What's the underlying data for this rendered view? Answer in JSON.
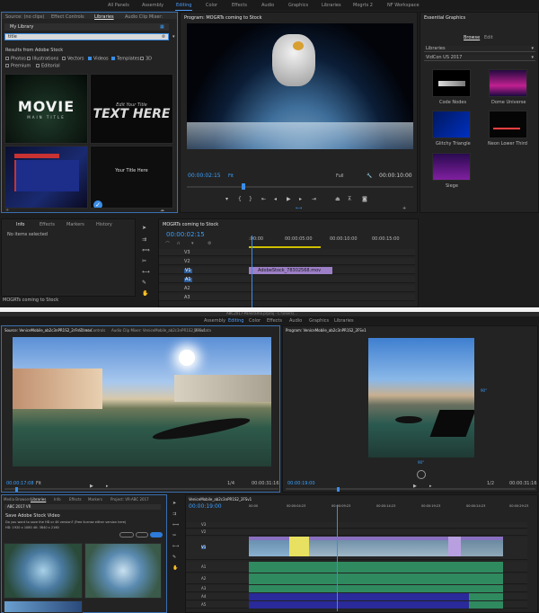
{
  "shot1": {
    "workspaces": [
      "All Panels",
      "Assembly",
      "Editing",
      "Color",
      "Effects",
      "Audio",
      "Graphics",
      "Libraries",
      "Mogrts 2",
      "NF Workspace"
    ],
    "source_tabs": [
      "Source: (no clips)",
      "Effect Controls",
      "Libraries",
      "Audio Clip Mixer:"
    ],
    "library_name": "My Library",
    "search_value": "title",
    "results_header": "Results from Adobe Stock",
    "filters": [
      {
        "label": "Photos",
        "on": false
      },
      {
        "label": "Illustrations",
        "on": false
      },
      {
        "label": "Vectors",
        "on": false
      },
      {
        "label": "Videos",
        "on": true
      },
      {
        "label": "Templates",
        "on": true
      },
      {
        "label": "3D",
        "on": false
      },
      {
        "label": "Premium",
        "on": false
      },
      {
        "label": "Editorial",
        "on": false
      }
    ],
    "thumb_movie": "MOVIE",
    "thumb_movie_sub": "MAIN TITLE",
    "thumb_edit": "Edit Your Title",
    "thumb_text": "TEXT HERE",
    "thumb_your_title": "Your Title Here",
    "program_title": "Program: MOGRTs coming to Stock",
    "timecode_in": "00:00:02:15",
    "fit": "Fit",
    "full": "Full",
    "timecode_end": "00:00:10:00",
    "info_tabs": [
      "Info",
      "Effects",
      "Markers",
      "History"
    ],
    "no_items": "No items selected",
    "bottom_label": "MOGRTs coming to Stock",
    "seq_title": "MOGRTs coming to Stock",
    "seq_time": "00:00:02:15",
    "ruler": [
      ":00:00",
      "00:00:05:00",
      "00:00:10:00",
      "00:00:15:00"
    ],
    "clip_name": "AdobeStock_78302568.mov",
    "tracks": [
      "V3",
      "V2",
      "V1",
      "A1",
      "A2",
      "A3"
    ],
    "eg_title": "Essential Graphics",
    "eg_tabs": [
      "Browse",
      "Edit"
    ],
    "eg_dropdown1": "Libraries",
    "eg_dropdown2": "VidCon US 2017",
    "eg_items": [
      "Code Nodes",
      "Dome Universe",
      "Glitchy Triangle",
      "Neon Lower Third",
      "Siege"
    ]
  },
  "shot2": {
    "window_title": "ABC2017-Panorama.prproj - C:\\Users\\...",
    "workspaces": [
      "Assembly",
      "Editing",
      "Color",
      "Effects",
      "Audio",
      "Graphics",
      "Libraries"
    ],
    "source_title": "Source: VeniceMobile_ab2c3nPR1S2_2rFrn1.mov",
    "effect_controls": "Effect Controls",
    "audio_mixer": "Audio Clip Mixer: VeniceMobile_ab2c3nPR1S2_2FSv1",
    "metadata": "Metadata",
    "program_title": "Program: VeniceMobile_ab2c3nPR1S2_2FSv1",
    "src_tc": "00:00:17:08",
    "src_fit": "Fit",
    "src_full": "1/4",
    "src_end": "00:00:31:16",
    "prog_tc": "00:00:19:00",
    "prog_full": "1/2",
    "prog_end": "00:00:31:16",
    "angle_right": "90°",
    "angle_bottom": "90°",
    "lib_tabs": [
      "Media Browser",
      "Libraries",
      "Info",
      "Effects",
      "Markers",
      "Project: VR-ABC 2017"
    ],
    "lib_name": "ABC 2017 VR",
    "save_heading": "Save Adobe Stock Video",
    "save_question": "Do you want to save the HD or 4K version? (Free license either version here)",
    "save_sizes": "HD: 1920 x 1080    4K: 3840 x 2160",
    "btn_cancel": "Cancel",
    "btn_hd": "HD",
    "btn_4k": "4K",
    "seq_title": "VeniceMobile_ab2c3nPR1S2_2FSv1",
    "seq_time": "00:00:19:00",
    "ruler": [
      "00:00",
      "00:00:04:23",
      "00:00:09:23",
      "00:00:14:23",
      "00:00:19:23",
      "00:00:24:23",
      "00:00:29:23"
    ],
    "tracks": [
      "V3",
      "V2",
      "V1",
      "A1",
      "A2",
      "A3",
      "A4",
      "A5"
    ]
  }
}
